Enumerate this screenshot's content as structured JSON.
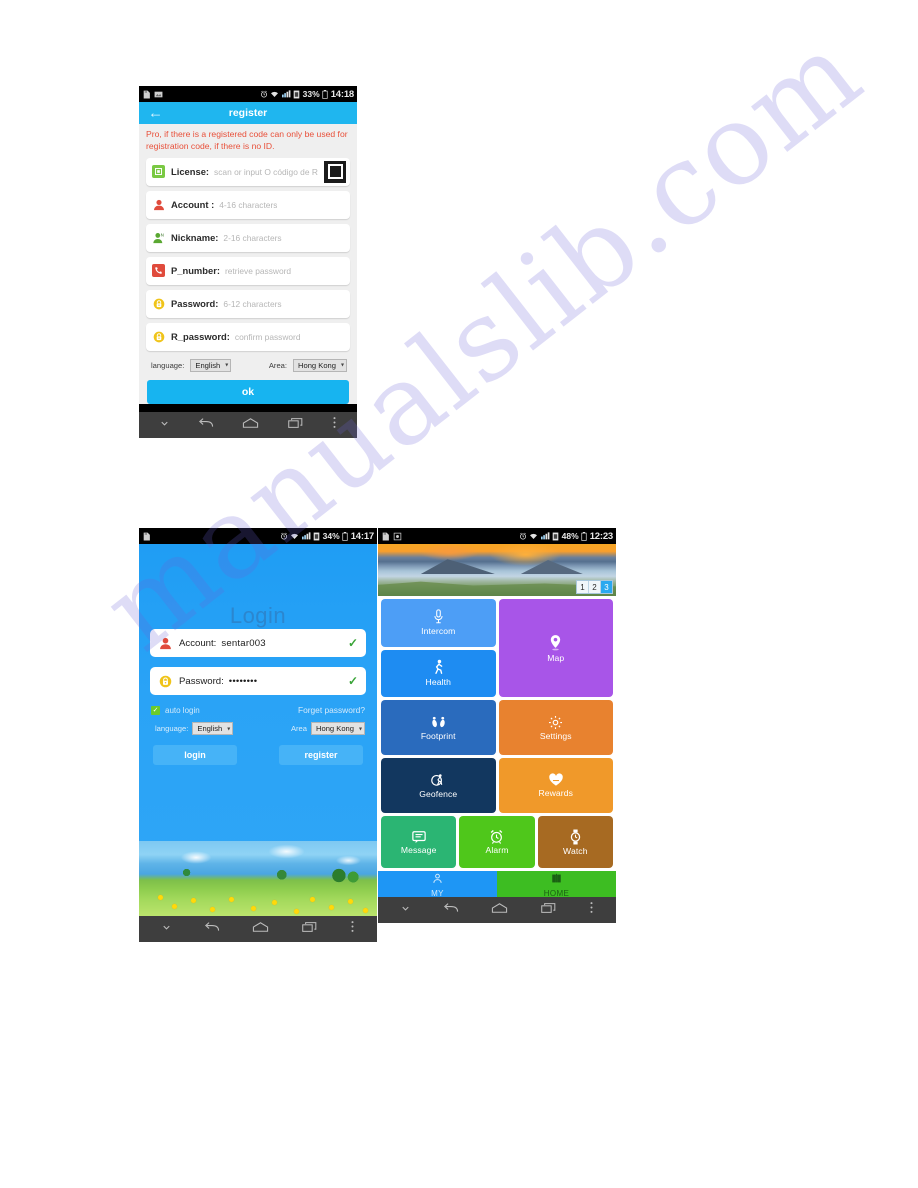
{
  "watermark": {
    "text": "manualslib.com"
  },
  "register_screen": {
    "statusbar": {
      "time": "14:18",
      "battery": "33%",
      "icons": [
        "sd-card-icon",
        "image-icon",
        "alarm-icon",
        "wifi-icon",
        "signal-icon",
        "sim-icon"
      ]
    },
    "title": "register",
    "back_label": "←",
    "notice": "Pro, if there is a registered code can only be used for registration code, if there is no ID.",
    "fields": [
      {
        "label": "License:",
        "placeholder": "scan or input O código de R",
        "icon": "license-icon",
        "icon_color": "#7ac943",
        "has_qr": true
      },
      {
        "label": "Account :",
        "placeholder": "4-16 characters",
        "icon": "person-icon",
        "icon_color": "#e04b3c",
        "has_qr": false
      },
      {
        "label": "Nickname:",
        "placeholder": "2-16 characters",
        "icon": "person-tag-icon",
        "icon_color": "#5aa832",
        "has_qr": false
      },
      {
        "label": "P_number:",
        "placeholder": "retrieve password",
        "icon": "phone-icon",
        "icon_color": "#e04b3c",
        "has_qr": false
      },
      {
        "label": "Password:",
        "placeholder": "6-12 characters",
        "icon": "lock-icon",
        "icon_color": "#f0c419",
        "has_qr": false
      },
      {
        "label": "R_password:",
        "placeholder": "confirm password",
        "icon": "lock-icon",
        "icon_color": "#f0c419",
        "has_qr": false
      }
    ],
    "language_label": "language:",
    "language_value": "English",
    "area_label": "Area:",
    "area_value": "Hong Kong",
    "ok_label": "ok"
  },
  "login_screen": {
    "statusbar": {
      "time": "14:17",
      "battery": "34%"
    },
    "title": "Login",
    "account_label": "Account:",
    "account_value": "sentar003",
    "password_label": "Password:",
    "password_value": "••••••••",
    "auto_login_label": "auto login",
    "auto_login_checked": true,
    "forget_label": "Forget password?",
    "language_label": "language:",
    "language_value": "English",
    "area_label": "Area",
    "area_value": "Hong Kong",
    "login_label": "login",
    "register_label": "register"
  },
  "home_screen": {
    "statusbar": {
      "time": "12:23",
      "battery": "48%"
    },
    "banner": {
      "pages": [
        "1",
        "2",
        "3"
      ],
      "active_index": 2
    },
    "tiles": [
      {
        "label": "Intercom",
        "icon": "microphone-icon",
        "color": "#4d9ef6"
      },
      {
        "label": "Health",
        "icon": "running-person-icon",
        "color": "#1e8cf2"
      },
      {
        "label": "Map",
        "icon": "map-pin-icon",
        "color": "#a855e8"
      },
      {
        "label": "Footprint",
        "icon": "footprints-icon",
        "color": "#2a6bbd"
      },
      {
        "label": "Settings",
        "icon": "gear-icon",
        "color": "#e8822f"
      },
      {
        "label": "Geofence",
        "icon": "geofence-icon",
        "color": "#12375f"
      },
      {
        "label": "Rewards",
        "icon": "heart-icon",
        "color": "#f0992a"
      },
      {
        "label": "Message",
        "icon": "message-icon",
        "color": "#2bb573"
      },
      {
        "label": "Alarm",
        "icon": "alarm-clock-icon",
        "color": "#4fc71b"
      },
      {
        "label": "Watch",
        "icon": "watch-icon",
        "color": "#a76a22"
      }
    ],
    "bottom_tabs": [
      {
        "label": "MY",
        "icon": "person-outline-icon"
      },
      {
        "label": "HOME",
        "icon": "home-book-icon"
      }
    ]
  },
  "navbar": {
    "buttons": [
      "hide-keyboard-icon",
      "back-icon",
      "home-icon",
      "recents-icon",
      "menu-icon"
    ]
  }
}
